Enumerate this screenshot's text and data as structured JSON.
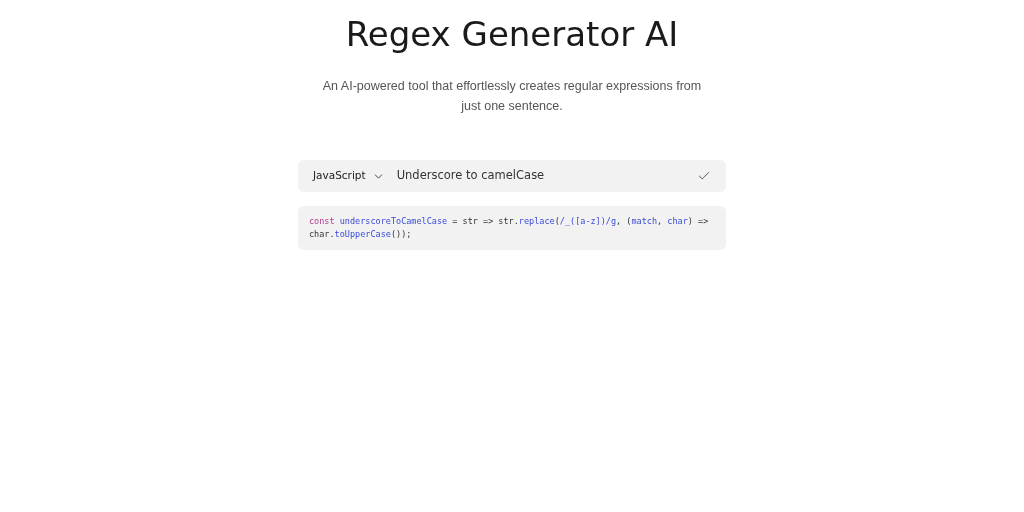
{
  "title": "Regex Generator AI",
  "subtitle": "An AI-powered tool that effortlessly creates regular expressions from just one sentence.",
  "prompt_bar": {
    "language": "JavaScript",
    "value": "Underscore to camelCase"
  },
  "code_lines": [
    [
      {
        "kind": "keyword",
        "text": "const "
      },
      {
        "kind": "name",
        "text": "underscoreToCamelCase"
      },
      {
        "kind": "plain",
        "text": " = str => str."
      },
      {
        "kind": "name",
        "text": "replace"
      },
      {
        "kind": "plain",
        "text": "("
      },
      {
        "kind": "name",
        "text": "/_([a-z])/g"
      },
      {
        "kind": "plain",
        "text": ", ("
      },
      {
        "kind": "name",
        "text": "match"
      },
      {
        "kind": "plain",
        "text": ", "
      },
      {
        "kind": "name",
        "text": "char"
      },
      {
        "kind": "plain",
        "text": ") =>"
      }
    ],
    [
      {
        "kind": "plain",
        "text": "char."
      },
      {
        "kind": "name",
        "text": "toUpperCase"
      },
      {
        "kind": "plain",
        "text": "());"
      }
    ]
  ]
}
